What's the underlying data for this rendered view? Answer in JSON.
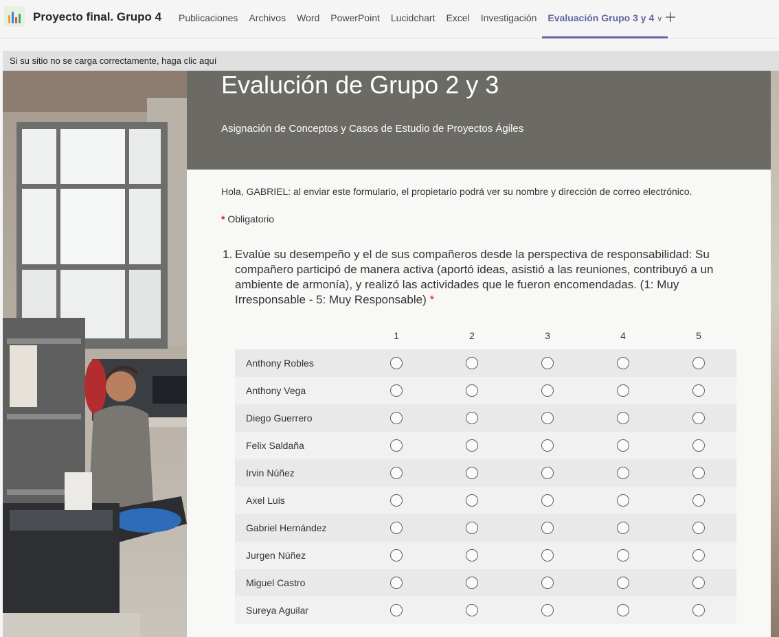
{
  "app": {
    "icon": "teams-app-icon",
    "team_title": "Proyecto final. Grupo 4"
  },
  "tabs": [
    {
      "label": "Publicaciones",
      "active": false
    },
    {
      "label": "Archivos",
      "active": false
    },
    {
      "label": "Word",
      "active": false
    },
    {
      "label": "PowerPoint",
      "active": false
    },
    {
      "label": "Lucidchart",
      "active": false
    },
    {
      "label": "Excel",
      "active": false
    },
    {
      "label": "Investigación",
      "active": false
    },
    {
      "label": "Evaluación Grupo 3 y 4",
      "active": true,
      "icon": "chevron-down-icon"
    }
  ],
  "add_tab_icon": "plus-icon",
  "notice": {
    "text": "Si su sitio no se carga correctamente, haga clic aquí"
  },
  "form": {
    "title": "Evalución de Grupo 2 y 3",
    "subtitle": "Asignación de Conceptos y Casos de Estudio de Proyectos Ágiles",
    "privacy_text": "Hola, GABRIEL: al enviar este formulario, el propietario podrá ver su nombre y dirección de correo electrónico.",
    "required_star": "*",
    "required_label": "Obligatorio",
    "question": {
      "number": "1.",
      "text": "Evalúe su desempeño y el de sus compañeros desde la perspectiva de responsabilidad: Su compañero participó de manera activa (aportó ideas, asistió a las reuniones, contribuyó a un ambiente de armonía), y realizó las actividades que le fueron encomendadas. (1: Muy Irresponsable - 5: Muy Responsable)",
      "required_star": "*",
      "scale": [
        "1",
        "2",
        "3",
        "4",
        "5"
      ],
      "rows": [
        "Anthony Robles",
        "Anthony Vega",
        "Diego Guerrero",
        "Felix Saldaña",
        "Irvin Núñez",
        "Axel Luis",
        "Gabriel Hernández",
        "Jurgen Núñez",
        "Miguel Castro",
        "Sureya Aguilar"
      ]
    }
  },
  "colors": {
    "accent": "#6264a7",
    "header_bg": "#6b6a65",
    "required": "#e81123"
  }
}
